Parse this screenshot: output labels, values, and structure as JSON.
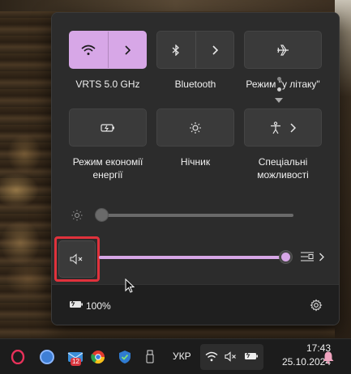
{
  "quick_settings": {
    "tiles": [
      {
        "label": "VRTS 5.0 GHz",
        "icon": "wifi-icon",
        "active": true,
        "has_arrow": true
      },
      {
        "label": "Bluetooth",
        "icon": "bluetooth-icon",
        "active": false,
        "has_arrow": true
      },
      {
        "label": "Режим \"у літаку\"",
        "icon": "airplane-icon",
        "active": false,
        "has_arrow": false
      },
      {
        "label": "Режим економії енергії",
        "icon": "battery-saver-icon",
        "active": false,
        "has_arrow": false
      },
      {
        "label": "Нічник",
        "icon": "night-light-icon",
        "active": false,
        "has_arrow": false
      },
      {
        "label": "Спеціальні можливості",
        "icon": "accessibility-icon",
        "active": false,
        "has_arrow": true
      }
    ],
    "brightness": {
      "icon": "sun-icon",
      "value": 0
    },
    "volume": {
      "icon": "speaker-muted-icon",
      "value": 100,
      "muted": true,
      "output_icon": "audio-output-icon"
    },
    "battery": {
      "icon": "battery-charging-icon",
      "percent": "100%"
    },
    "settings_icon": "gear-icon",
    "accent_color": "#d7a7e7",
    "highlight_color": "#e0323c"
  },
  "taskbar": {
    "apps": [
      "opera-gx-icon",
      "avatar-icon",
      "mail-icon",
      "chrome-icon",
      "shield-icon",
      "usb-icon"
    ],
    "mail_badge": "12",
    "language": "УКР",
    "tray": [
      "wifi-icon",
      "speaker-muted-icon",
      "battery-charging-icon"
    ],
    "time": "17:43",
    "date": "25.10.2024",
    "notification_icon": "bell-icon"
  }
}
